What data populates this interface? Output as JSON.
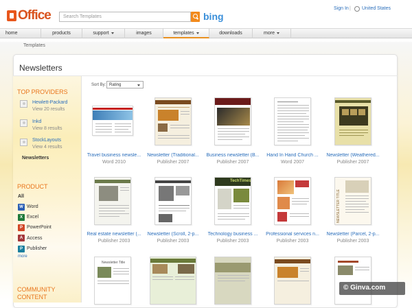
{
  "header": {
    "logo": "Office",
    "search_placeholder": "Search Templates",
    "bing": "bing",
    "sign_in": "Sign In",
    "separator": "|",
    "country": "United States"
  },
  "nav": {
    "items": [
      "home",
      "products",
      "support",
      "images",
      "templates",
      "downloads",
      "more"
    ],
    "active": "templates"
  },
  "breadcrumb": "Templates",
  "page_title": "Newsletters",
  "sidebar": {
    "top_providers_heading": "TOP PROVIDERS",
    "providers": [
      {
        "name": "Hewlett-Packard",
        "count": "View 20 results"
      },
      {
        "name": "Inkd",
        "count": "View 8 results"
      },
      {
        "name": "StockLayouts",
        "count": "View 4 results"
      }
    ],
    "current": "Newsletters",
    "product_heading": "PRODUCT",
    "product_all": "All",
    "products": [
      {
        "label": "Word",
        "icon": "word-icon",
        "color": "#2b5fb4"
      },
      {
        "label": "Excel",
        "icon": "excel-icon",
        "color": "#1f7a3a"
      },
      {
        "label": "PowerPoint",
        "icon": "powerpoint-icon",
        "color": "#d24726"
      },
      {
        "label": "Access",
        "icon": "access-icon",
        "color": "#a4373a"
      },
      {
        "label": "Publisher",
        "icon": "publisher-icon",
        "color": "#1a7f9e"
      }
    ],
    "more": "more",
    "community_heading_1": "COMMUNITY",
    "community_heading_2": "CONTENT"
  },
  "sort": {
    "label": "Sort By:",
    "value": "Rating"
  },
  "templates": [
    {
      "name": "Travel business newsle...",
      "product": "Word 2010"
    },
    {
      "name": "Newsletter (Traditional...",
      "product": "Publisher 2007"
    },
    {
      "name": "Business newsletter (B...",
      "product": "Publisher 2007"
    },
    {
      "name": "Hand In Hand Church ...",
      "product": "Word 2007"
    },
    {
      "name": "Newsletter (Weathered...",
      "product": "Publisher 2007"
    },
    {
      "name": "Real estate newsletter (...",
      "product": "Publisher 2003"
    },
    {
      "name": "Newsletter (Scroll, 2-p...",
      "product": "Publisher 2003"
    },
    {
      "name": "Technology business ...",
      "product": "Publisher 2003"
    },
    {
      "name": "Professional services n...",
      "product": "Publisher 2003"
    },
    {
      "name": "Newsletter (Parcel, 2-p...",
      "product": "Publisher 2003"
    },
    {
      "name": "",
      "product": ""
    },
    {
      "name": "",
      "product": ""
    },
    {
      "name": "",
      "product": ""
    },
    {
      "name": "",
      "product": ""
    },
    {
      "name": "",
      "product": ""
    }
  ],
  "thumb_texts": {
    "tech_times": "TechTimes",
    "newsletter_title": "NEWSLETTER TITLE",
    "newsletter_title_small": "Newsletter Title"
  },
  "watermark": "© Ginva.com"
}
